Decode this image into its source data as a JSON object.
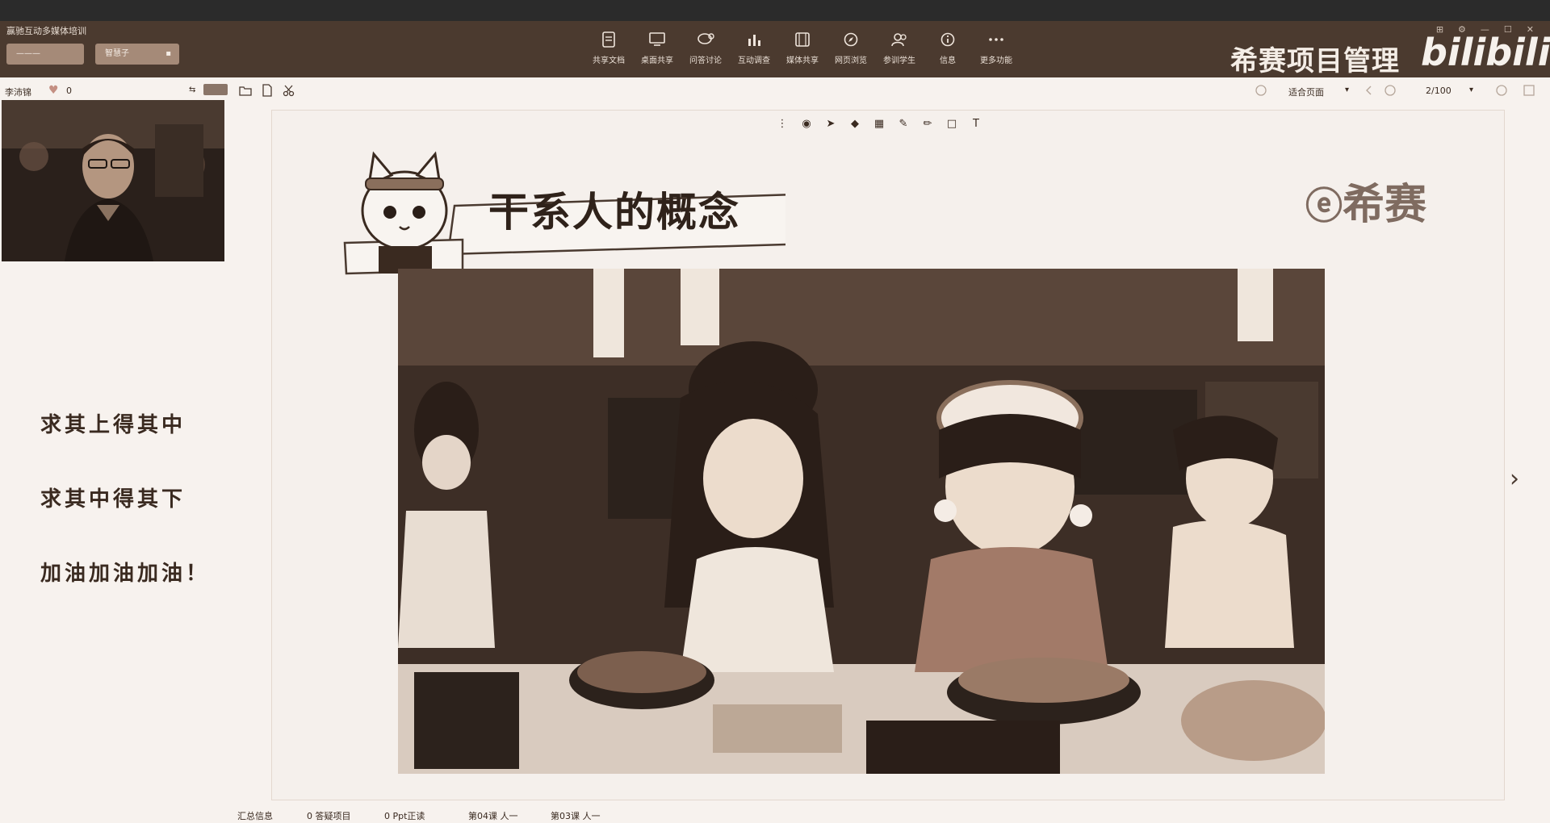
{
  "app": {
    "title": "赢驰互动多媒体培训",
    "left_button_label": "———",
    "right_button_label": "智慧子"
  },
  "toolbar": [
    {
      "label": "共享文档",
      "icon": "document-icon"
    },
    {
      "label": "桌面共享",
      "icon": "desktop-icon"
    },
    {
      "label": "问答讨论",
      "icon": "chat-icon"
    },
    {
      "label": "互动调查",
      "icon": "poll-chart-icon"
    },
    {
      "label": "媒体共享",
      "icon": "media-icon"
    },
    {
      "label": "网页浏览",
      "icon": "compass-icon"
    },
    {
      "label": "参训学生",
      "icon": "users-icon"
    },
    {
      "label": "信息",
      "icon": "info-icon"
    },
    {
      "label": "更多功能",
      "icon": "more-icon"
    }
  ],
  "brand": {
    "name": "希赛项目管理",
    "watermark": "bilibili"
  },
  "speaker": {
    "name": "李沛锦",
    "likes": "0"
  },
  "mottos": [
    "求其上得其中",
    "求其中得其下",
    "加油加油加油！"
  ],
  "viewer": {
    "zoom": "适合页面",
    "page": "2/100"
  },
  "slide": {
    "title": "干系人的概念",
    "logo": "希赛"
  },
  "status": {
    "summary": "汇总信息",
    "questions": "0 答疑项目",
    "ppt": "0 Ppt正读",
    "item3": "第04课 人一",
    "item4": "第03课 人一"
  }
}
